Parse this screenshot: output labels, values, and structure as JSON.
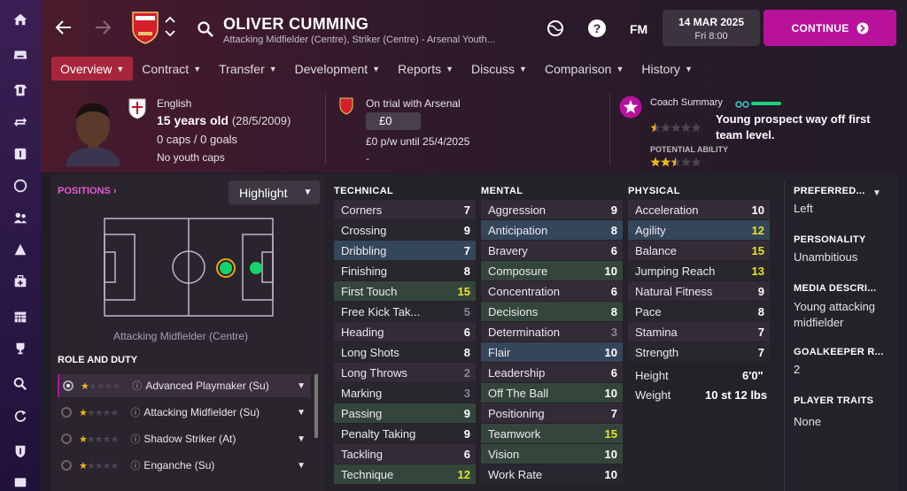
{
  "sidebar": {
    "items": [
      "home-icon",
      "inbox-icon",
      "squad-icon",
      "transfers-icon",
      "scouting-icon",
      "competition-icon",
      "staff-icon",
      "tactics-icon",
      "medical-icon",
      "schedule-icon",
      "trophy-icon",
      "search-icon",
      "refresh-icon",
      "club-icon",
      "finances-icon"
    ]
  },
  "topbar": {
    "player_name": "OLIVER CUMMING",
    "player_positions": "Attacking Midfielder (Centre), Striker (Centre) - Arsenal Youth...",
    "fm_label": "FM",
    "date": "14 MAR 2025",
    "time": "Fri 8:00",
    "continue_label": "CONTINUE"
  },
  "tabs": [
    {
      "label": "Overview",
      "active": true
    },
    {
      "label": "Contract"
    },
    {
      "label": "Transfer"
    },
    {
      "label": "Development"
    },
    {
      "label": "Reports"
    },
    {
      "label": "Discuss"
    },
    {
      "label": "Comparison"
    },
    {
      "label": "History"
    }
  ],
  "profile": {
    "nationality": "English",
    "age": "15 years old",
    "dob": "(28/5/2009)",
    "caps": "0 caps / 0 goals",
    "youth_caps": "No youth caps"
  },
  "contract": {
    "status": "On trial with Arsenal",
    "value": "£0",
    "wage": "£0 p/w until 25/4/2025",
    "extra": "-"
  },
  "coach": {
    "title": "Coach Summary",
    "summary": "Young prospect way off first team level.",
    "potential_label": "POTENTIAL ABILITY",
    "current_stars": 0.5,
    "potential_stars": 2.5
  },
  "positions": {
    "title": "POSITIONS",
    "highlight_label": "Highlight",
    "position_caption": "Attacking Midfielder (Centre)",
    "role_title": "ROLE AND DUTY",
    "roles": [
      {
        "name": "Advanced Playmaker (Su)",
        "selected": true
      },
      {
        "name": "Attacking Midfielder (Su)"
      },
      {
        "name": "Shadow Striker (At)"
      },
      {
        "name": "Enganche (Su)"
      }
    ]
  },
  "technical": {
    "title": "TECHNICAL",
    "attrs": [
      {
        "name": "Corners",
        "value": "7"
      },
      {
        "name": "Crossing",
        "value": "9"
      },
      {
        "name": "Dribbling",
        "value": "7"
      },
      {
        "name": "Finishing",
        "value": "8"
      },
      {
        "name": "First Touch",
        "value": "15"
      },
      {
        "name": "Free Kick Tak...",
        "value": "5"
      },
      {
        "name": "Heading",
        "value": "6"
      },
      {
        "name": "Long Shots",
        "value": "8"
      },
      {
        "name": "Long Throws",
        "value": "2"
      },
      {
        "name": "Marking",
        "value": "3"
      },
      {
        "name": "Passing",
        "value": "9"
      },
      {
        "name": "Penalty Taking",
        "value": "9"
      },
      {
        "name": "Tackling",
        "value": "6"
      },
      {
        "name": "Technique",
        "value": "12"
      }
    ]
  },
  "mental": {
    "title": "MENTAL",
    "attrs": [
      {
        "name": "Aggression",
        "value": "9"
      },
      {
        "name": "Anticipation",
        "value": "8"
      },
      {
        "name": "Bravery",
        "value": "6"
      },
      {
        "name": "Composure",
        "value": "10"
      },
      {
        "name": "Concentration",
        "value": "6"
      },
      {
        "name": "Decisions",
        "value": "8"
      },
      {
        "name": "Determination",
        "value": "3"
      },
      {
        "name": "Flair",
        "value": "10"
      },
      {
        "name": "Leadership",
        "value": "6"
      },
      {
        "name": "Off The Ball",
        "value": "10"
      },
      {
        "name": "Positioning",
        "value": "7"
      },
      {
        "name": "Teamwork",
        "value": "15"
      },
      {
        "name": "Vision",
        "value": "10"
      },
      {
        "name": "Work Rate",
        "value": "10"
      }
    ]
  },
  "physical": {
    "title": "PHYSICAL",
    "attrs": [
      {
        "name": "Acceleration",
        "value": "10"
      },
      {
        "name": "Agility",
        "value": "12"
      },
      {
        "name": "Balance",
        "value": "15"
      },
      {
        "name": "Jumping Reach",
        "value": "13"
      },
      {
        "name": "Natural Fitness",
        "value": "9"
      },
      {
        "name": "Pace",
        "value": "8"
      },
      {
        "name": "Stamina",
        "value": "7"
      },
      {
        "name": "Strength",
        "value": "7"
      }
    ],
    "height_label": "Height",
    "height": "6'0\"",
    "weight_label": "Weight",
    "weight": "10 st 12 lbs"
  },
  "right_info": {
    "preferred_label": "PREFERRED...",
    "preferred": "Left",
    "personality_label": "PERSONALITY",
    "personality": "Unambitious",
    "media_label": "MEDIA DESCRI...",
    "media": "Young attacking midfielder",
    "gk_label": "GOALKEEPER R...",
    "gk": "2",
    "traits_label": "PLAYER TRAITS",
    "traits": "None"
  },
  "colors": {
    "accent": "#b8129c",
    "active_tab": "#a8263d",
    "value_yellow": "#e8e22d",
    "position_green": "#15d46a"
  }
}
